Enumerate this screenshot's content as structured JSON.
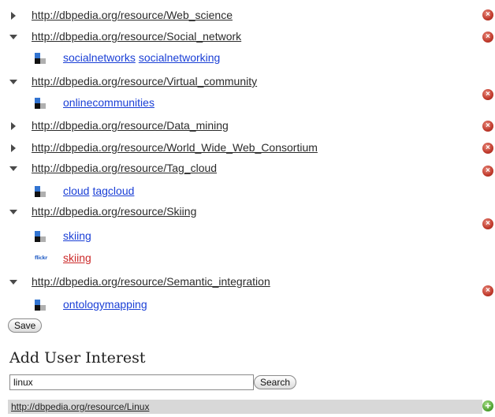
{
  "interests": [
    {
      "uri": "http://dbpedia.org/resource/Web_science",
      "expanded": false,
      "sources": []
    },
    {
      "uri": "http://dbpedia.org/resource/Social_network",
      "expanded": true,
      "sources": [
        {
          "icon": "delicious-icon",
          "tags": [
            {
              "label": "socialnetworks"
            },
            {
              "label": "socialnetworking"
            }
          ]
        }
      ]
    },
    {
      "uri": "http://dbpedia.org/resource/Virtual_community",
      "expanded": true,
      "sources": [
        {
          "icon": "delicious-icon",
          "tags": [
            {
              "label": "onlinecommunities"
            }
          ]
        }
      ]
    },
    {
      "uri": "http://dbpedia.org/resource/Data_mining",
      "expanded": false,
      "sources": []
    },
    {
      "uri": "http://dbpedia.org/resource/World_Wide_Web_Consortium",
      "expanded": false,
      "sources": []
    },
    {
      "uri": "http://dbpedia.org/resource/Tag_cloud",
      "expanded": true,
      "sources": [
        {
          "icon": "delicious-icon",
          "tags": [
            {
              "label": "cloud"
            },
            {
              "label": "tagcloud"
            }
          ]
        }
      ]
    },
    {
      "uri": "http://dbpedia.org/resource/Skiing",
      "expanded": true,
      "sources": [
        {
          "icon": "delicious-icon",
          "tags": [
            {
              "label": "skiing"
            }
          ]
        },
        {
          "icon": "flickr-icon",
          "icon_text": "flickr",
          "tags": [
            {
              "label": "skiing",
              "color": "#cc2a2a"
            }
          ]
        }
      ]
    },
    {
      "uri": "http://dbpedia.org/resource/Semantic_integration",
      "expanded": true,
      "sources": [
        {
          "icon": "delicious-icon",
          "tags": [
            {
              "label": "ontologymapping"
            }
          ]
        }
      ]
    }
  ],
  "save_label": "Save",
  "add_interest": {
    "heading": "Add User Interest",
    "search_value": "linux",
    "search_label": "Search",
    "results": [
      {
        "uri": "http://dbpedia.org/resource/Linux"
      }
    ]
  },
  "icons": {
    "collapsed": "triangle-right-icon",
    "expanded": "triangle-down-icon",
    "remove": "remove-icon",
    "add": "add-icon"
  },
  "colors": {
    "tag_link": "#1a3fd6",
    "remove": "#c0392b",
    "add": "#4ea02f",
    "result_bg": "#d8d8d8"
  }
}
